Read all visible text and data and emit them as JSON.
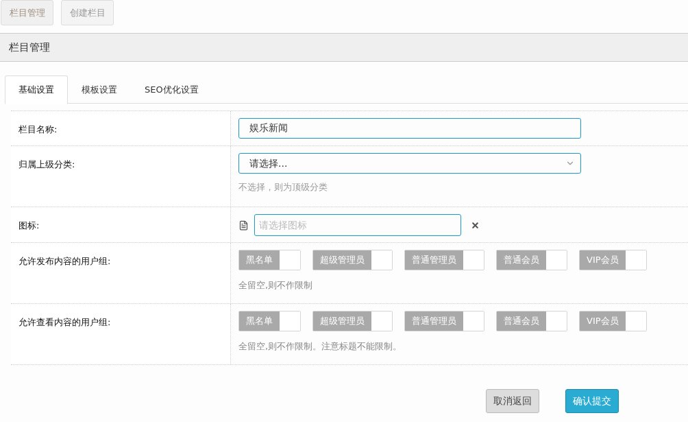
{
  "top_buttons": [
    {
      "label": "栏目管理",
      "selected": true
    },
    {
      "label": "创建栏目",
      "selected": false
    }
  ],
  "panel_title": "栏目管理",
  "tabs": [
    {
      "label": "基础设置",
      "selected": true
    },
    {
      "label": "模板设置",
      "selected": false
    },
    {
      "label": "SEO优化设置",
      "selected": false
    }
  ],
  "fields": [
    {
      "kind": "text",
      "label": "栏目名称:",
      "value": "娱乐新闻"
    },
    {
      "kind": "select",
      "label": "归属上级分类:",
      "value": "请选择...",
      "help": "不选择，则为顶级分类"
    },
    {
      "kind": "icon",
      "label": "图标:",
      "placeholder": "请选择图标"
    },
    {
      "kind": "toggles",
      "label": "允许发布内容的用户组:",
      "help": "全留空,则不作限制",
      "toggles": [
        {
          "label": "黑名单",
          "checked": false
        },
        {
          "label": "超级管理员",
          "checked": false
        },
        {
          "label": "普通管理员",
          "checked": false
        },
        {
          "label": "普通会员",
          "checked": false
        },
        {
          "label": "VIP会员",
          "checked": false
        }
      ]
    },
    {
      "kind": "toggles",
      "label": "允许查看内容的用户组:",
      "help": "全留空,则不作限制。注意标题不能限制。",
      "toggles": [
        {
          "label": "黑名单",
          "checked": false
        },
        {
          "label": "超级管理员",
          "checked": false
        },
        {
          "label": "普通管理员",
          "checked": false
        },
        {
          "label": "普通会员",
          "checked": false
        },
        {
          "label": "VIP会员",
          "checked": false
        }
      ]
    }
  ],
  "actions": [
    {
      "label": "取消返回",
      "kind": "secondary"
    },
    {
      "label": "确认提交",
      "kind": "primary"
    }
  ]
}
